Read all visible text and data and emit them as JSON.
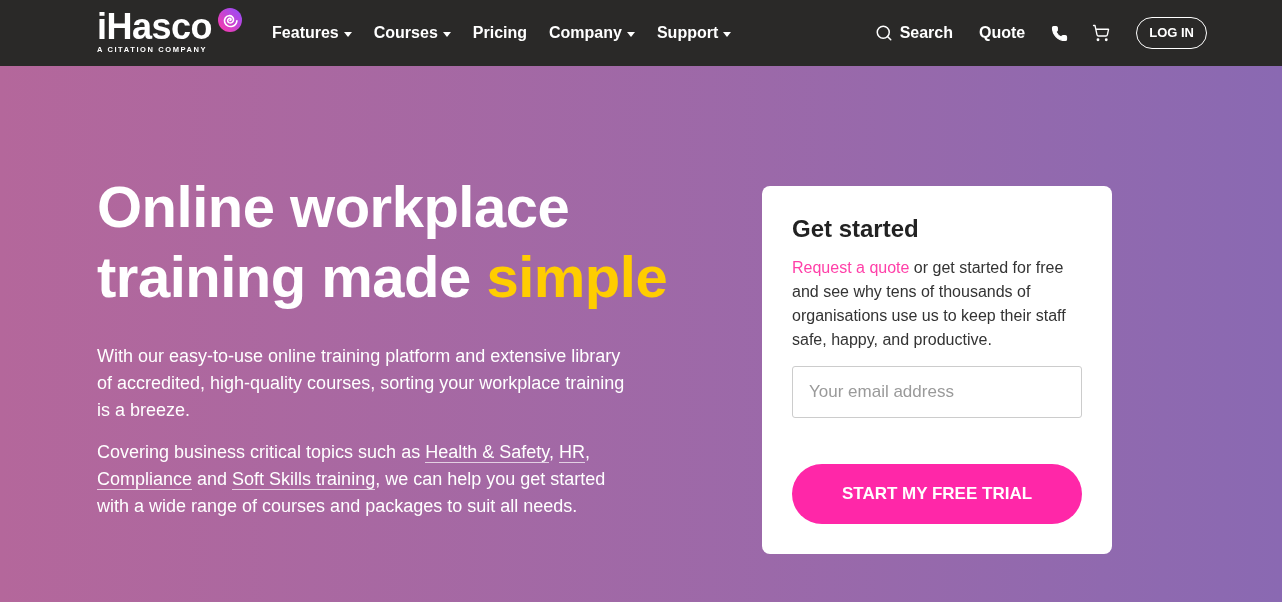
{
  "header": {
    "logo": {
      "wordmark": "iHasco",
      "tagline": "A CITATION COMPANY"
    },
    "nav": [
      {
        "label": "Features",
        "dropdown": true
      },
      {
        "label": "Courses",
        "dropdown": true
      },
      {
        "label": "Pricing",
        "dropdown": false
      },
      {
        "label": "Company",
        "dropdown": true
      },
      {
        "label": "Support",
        "dropdown": true
      }
    ],
    "search": {
      "label": "Search"
    },
    "quote": {
      "label": "Quote"
    },
    "login": {
      "label": "LOG IN"
    }
  },
  "hero": {
    "headline": [
      {
        "text": "Online workplace training made ",
        "highlight": false
      },
      {
        "text": "simple",
        "highlight": true
      }
    ],
    "paragraphs": [
      {
        "segments": [
          {
            "text": "With our easy-to-use online training platform and extensive library of accredited, high-quality courses, sorting your workplace training is a breeze.",
            "link": false
          }
        ]
      },
      {
        "segments": [
          {
            "text": "Covering business critical topics such as ",
            "link": false
          },
          {
            "text": "Health & Safety",
            "link": true
          },
          {
            "text": ", ",
            "link": false
          },
          {
            "text": "HR",
            "link": true
          },
          {
            "text": ", ",
            "link": false
          },
          {
            "text": "Compliance",
            "link": true
          },
          {
            "text": " and ",
            "link": false
          },
          {
            "text": "Soft Skills training",
            "link": true
          },
          {
            "text": ", we can help you get started with a wide range of courses and packages to suit all needs.",
            "link": false
          }
        ]
      }
    ]
  },
  "signup_card": {
    "title": "Get started",
    "intro": [
      {
        "text": "Request a quote",
        "link": true
      },
      {
        "text": " or get started for free and see why tens of thousands of organisations use us to keep their staff safe, happy, and productive.",
        "link": false
      }
    ],
    "email_field": {
      "placeholder": "Your email address"
    },
    "button": {
      "label": "START MY FREE TRIAL"
    }
  }
}
